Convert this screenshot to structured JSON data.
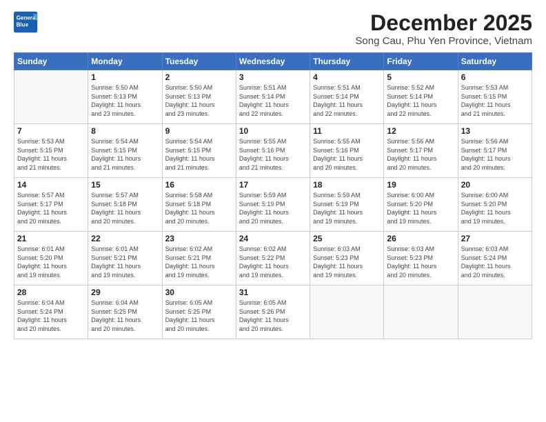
{
  "logo": {
    "line1": "General",
    "line2": "Blue"
  },
  "title": "December 2025",
  "subtitle": "Song Cau, Phu Yen Province, Vietnam",
  "headers": [
    "Sunday",
    "Monday",
    "Tuesday",
    "Wednesday",
    "Thursday",
    "Friday",
    "Saturday"
  ],
  "weeks": [
    [
      {
        "day": "",
        "info": ""
      },
      {
        "day": "1",
        "info": "Sunrise: 5:50 AM\nSunset: 5:13 PM\nDaylight: 11 hours\nand 23 minutes."
      },
      {
        "day": "2",
        "info": "Sunrise: 5:50 AM\nSunset: 5:13 PM\nDaylight: 11 hours\nand 23 minutes."
      },
      {
        "day": "3",
        "info": "Sunrise: 5:51 AM\nSunset: 5:14 PM\nDaylight: 11 hours\nand 22 minutes."
      },
      {
        "day": "4",
        "info": "Sunrise: 5:51 AM\nSunset: 5:14 PM\nDaylight: 11 hours\nand 22 minutes."
      },
      {
        "day": "5",
        "info": "Sunrise: 5:52 AM\nSunset: 5:14 PM\nDaylight: 11 hours\nand 22 minutes."
      },
      {
        "day": "6",
        "info": "Sunrise: 5:53 AM\nSunset: 5:15 PM\nDaylight: 11 hours\nand 21 minutes."
      }
    ],
    [
      {
        "day": "7",
        "info": "Sunrise: 5:53 AM\nSunset: 5:15 PM\nDaylight: 11 hours\nand 21 minutes."
      },
      {
        "day": "8",
        "info": "Sunrise: 5:54 AM\nSunset: 5:15 PM\nDaylight: 11 hours\nand 21 minutes."
      },
      {
        "day": "9",
        "info": "Sunrise: 5:54 AM\nSunset: 5:15 PM\nDaylight: 11 hours\nand 21 minutes."
      },
      {
        "day": "10",
        "info": "Sunrise: 5:55 AM\nSunset: 5:16 PM\nDaylight: 11 hours\nand 21 minutes."
      },
      {
        "day": "11",
        "info": "Sunrise: 5:55 AM\nSunset: 5:16 PM\nDaylight: 11 hours\nand 20 minutes."
      },
      {
        "day": "12",
        "info": "Sunrise: 5:56 AM\nSunset: 5:17 PM\nDaylight: 11 hours\nand 20 minutes."
      },
      {
        "day": "13",
        "info": "Sunrise: 5:56 AM\nSunset: 5:17 PM\nDaylight: 11 hours\nand 20 minutes."
      }
    ],
    [
      {
        "day": "14",
        "info": "Sunrise: 5:57 AM\nSunset: 5:17 PM\nDaylight: 11 hours\nand 20 minutes."
      },
      {
        "day": "15",
        "info": "Sunrise: 5:57 AM\nSunset: 5:18 PM\nDaylight: 11 hours\nand 20 minutes."
      },
      {
        "day": "16",
        "info": "Sunrise: 5:58 AM\nSunset: 5:18 PM\nDaylight: 11 hours\nand 20 minutes."
      },
      {
        "day": "17",
        "info": "Sunrise: 5:59 AM\nSunset: 5:19 PM\nDaylight: 11 hours\nand 20 minutes."
      },
      {
        "day": "18",
        "info": "Sunrise: 5:59 AM\nSunset: 5:19 PM\nDaylight: 11 hours\nand 19 minutes."
      },
      {
        "day": "19",
        "info": "Sunrise: 6:00 AM\nSunset: 5:20 PM\nDaylight: 11 hours\nand 19 minutes."
      },
      {
        "day": "20",
        "info": "Sunrise: 6:00 AM\nSunset: 5:20 PM\nDaylight: 11 hours\nand 19 minutes."
      }
    ],
    [
      {
        "day": "21",
        "info": "Sunrise: 6:01 AM\nSunset: 5:20 PM\nDaylight: 11 hours\nand 19 minutes."
      },
      {
        "day": "22",
        "info": "Sunrise: 6:01 AM\nSunset: 5:21 PM\nDaylight: 11 hours\nand 19 minutes."
      },
      {
        "day": "23",
        "info": "Sunrise: 6:02 AM\nSunset: 5:21 PM\nDaylight: 11 hours\nand 19 minutes."
      },
      {
        "day": "24",
        "info": "Sunrise: 6:02 AM\nSunset: 5:22 PM\nDaylight: 11 hours\nand 19 minutes."
      },
      {
        "day": "25",
        "info": "Sunrise: 6:03 AM\nSunset: 5:23 PM\nDaylight: 11 hours\nand 19 minutes."
      },
      {
        "day": "26",
        "info": "Sunrise: 6:03 AM\nSunset: 5:23 PM\nDaylight: 11 hours\nand 20 minutes."
      },
      {
        "day": "27",
        "info": "Sunrise: 6:03 AM\nSunset: 5:24 PM\nDaylight: 11 hours\nand 20 minutes."
      }
    ],
    [
      {
        "day": "28",
        "info": "Sunrise: 6:04 AM\nSunset: 5:24 PM\nDaylight: 11 hours\nand 20 minutes."
      },
      {
        "day": "29",
        "info": "Sunrise: 6:04 AM\nSunset: 5:25 PM\nDaylight: 11 hours\nand 20 minutes."
      },
      {
        "day": "30",
        "info": "Sunrise: 6:05 AM\nSunset: 5:25 PM\nDaylight: 11 hours\nand 20 minutes."
      },
      {
        "day": "31",
        "info": "Sunrise: 6:05 AM\nSunset: 5:26 PM\nDaylight: 11 hours\nand 20 minutes."
      },
      {
        "day": "",
        "info": ""
      },
      {
        "day": "",
        "info": ""
      },
      {
        "day": "",
        "info": ""
      }
    ]
  ]
}
